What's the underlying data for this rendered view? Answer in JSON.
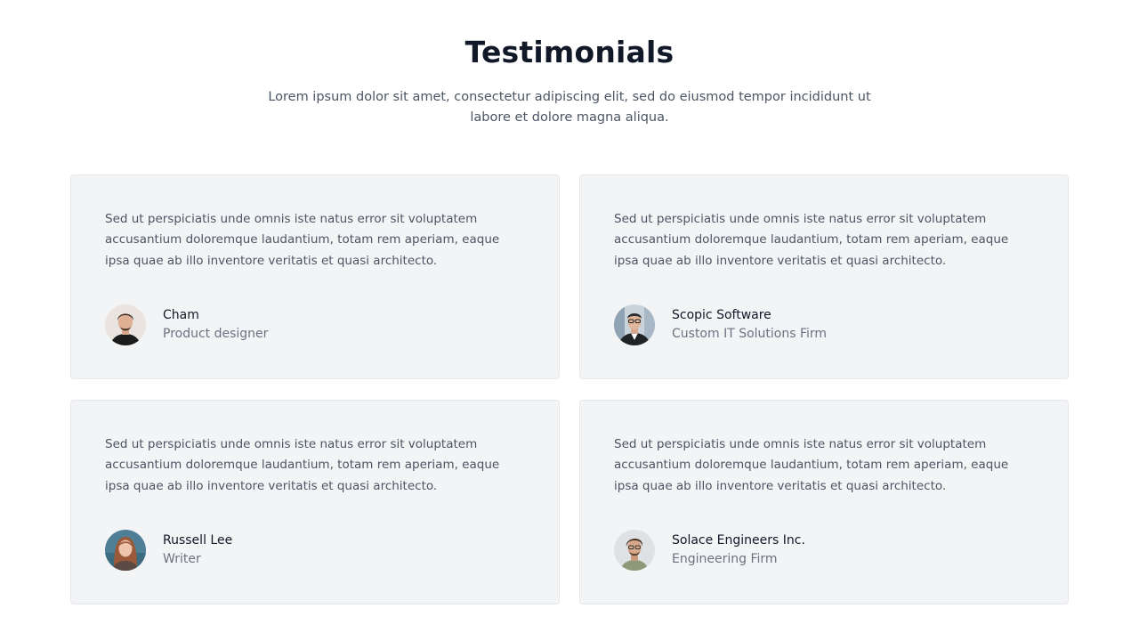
{
  "header": {
    "title": "Testimonials",
    "subtitle": "Lorem ipsum dolor sit amet, consectetur adipiscing elit, sed do eiusmod tempor incididunt ut labore et dolore magna aliqua."
  },
  "colors": {
    "title": "#111827",
    "body_text": "#4b5563",
    "card_background": "#f3f4f6",
    "card_border": "#e5e7eb"
  },
  "testimonials": [
    {
      "quote": "Sed ut perspiciatis unde omnis iste natus error sit voluptatem accusantium doloremque laudantium, totam rem aperiam, eaque ipsa quae ab illo inventore veritatis et quasi architecto.",
      "name": "Cham",
      "role": "Product designer",
      "avatar_icon": "avatar-photo-man-dark-hair"
    },
    {
      "quote": "Sed ut perspiciatis unde omnis iste natus error sit voluptatem accusantium doloremque laudantium, totam rem aperiam, eaque ipsa quae ab illo inventore veritatis et quasi architecto.",
      "name": "Scopic Software",
      "role": "Custom IT Solutions Firm",
      "avatar_icon": "avatar-photo-man-glasses-suit"
    },
    {
      "quote": "Sed ut perspiciatis unde omnis iste natus error sit voluptatem accusantium doloremque laudantium, totam rem aperiam, eaque ipsa quae ab illo inventore veritatis et quasi architecto.",
      "name": "Russell Lee",
      "role": "Writer",
      "avatar_icon": "avatar-photo-woman-auburn-hair"
    },
    {
      "quote": "Sed ut perspiciatis unde omnis iste natus error sit voluptatem accusantium doloremque laudantium, totam rem aperiam, eaque ipsa quae ab illo inventore veritatis et quasi architecto.",
      "name": "Solace Engineers Inc.",
      "role": "Engineering Firm",
      "avatar_icon": "avatar-photo-man-curly-hair"
    }
  ]
}
